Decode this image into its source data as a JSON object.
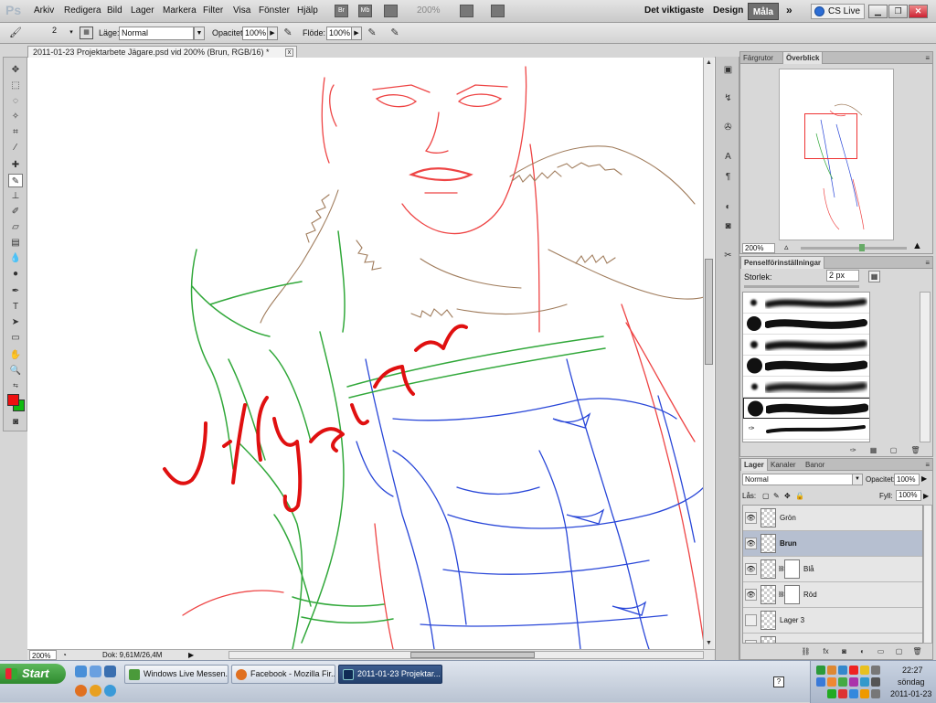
{
  "app": {
    "logo": "Ps",
    "menu": [
      "Arkiv",
      "Redigera",
      "Bild",
      "Lager",
      "Markera",
      "Filter",
      "Visa",
      "Fönster",
      "Hjälp"
    ],
    "toolbar_icons": [
      "Br",
      "Mb"
    ],
    "zoom": "200%",
    "workspaces": [
      "Det viktigaste",
      "Design"
    ],
    "workspace_active": "Måla",
    "more": "»",
    "cs_live": "CS Live"
  },
  "options": {
    "brush_size": "2",
    "mode_label": "Läge:",
    "mode_value": "Normal",
    "opacity_label": "Opacitet:",
    "opacity_value": "100%",
    "flow_label": "Flöde:",
    "flow_value": "100%"
  },
  "document": {
    "tab_title": "2011-01-23 Projektarbete Jägare.psd vid 200% (Brun, RGB/16) *",
    "close": "x",
    "status_zoom": "200%",
    "status_doc": "Dok: 9,61M/26,4M"
  },
  "colors": {
    "foreground": "#ee1111",
    "background": "#11bb11",
    "accent": "#6f6f6f"
  },
  "navigator": {
    "tabs": [
      "Färgrutor",
      "Överblick"
    ],
    "active_tab": "Överblick",
    "zoom": "200%"
  },
  "brush_panel": {
    "title": "Penselförinställningar",
    "size_label": "Storlek:",
    "size_value": "2 px"
  },
  "layers_panel": {
    "tabs": [
      "Lager",
      "Kanaler",
      "Banor"
    ],
    "active_tab": "Lager",
    "blend_mode": "Normal",
    "opacity_label": "Opacitet:",
    "opacity_value": "100%",
    "lock_label": "Lås:",
    "fill_label": "Fyll:",
    "fill_value": "100%",
    "layers": [
      {
        "name": "Grön",
        "visible": true,
        "selected": false,
        "mask": false
      },
      {
        "name": "Brun",
        "visible": true,
        "selected": true,
        "mask": false
      },
      {
        "name": "Blå",
        "visible": true,
        "selected": false,
        "mask": true
      },
      {
        "name": "Röd",
        "visible": true,
        "selected": false,
        "mask": true
      },
      {
        "name": "Lager 3",
        "visible": false,
        "selected": false,
        "mask": false
      }
    ]
  },
  "taskbar": {
    "start": "Start",
    "tasks": [
      "Windows Live Messen...",
      "Facebook - Mozilla Fir...",
      "2011-01-23 Projektar..."
    ],
    "active_task": 2,
    "help": "?",
    "time": "22:27",
    "day": "söndag",
    "date": "2011-01-23"
  }
}
